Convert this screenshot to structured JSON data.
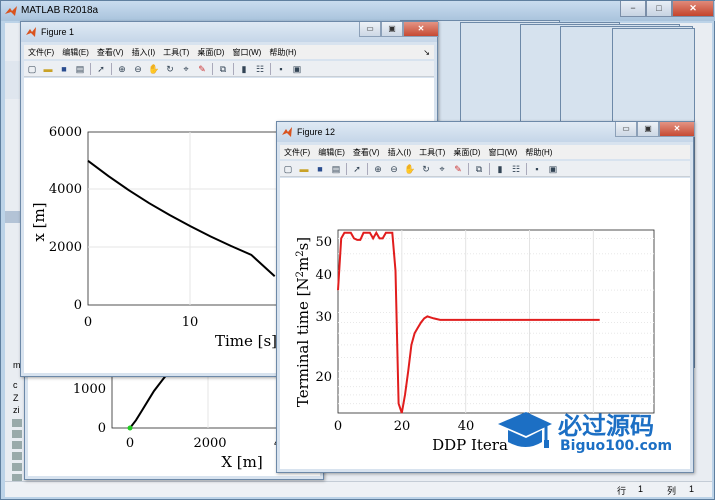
{
  "app": {
    "title": "MATLAB R2018a",
    "window_buttons": [
      "−",
      "□",
      "✕"
    ],
    "status_row_label": "行",
    "status_row_value": "1",
    "status_col_label": "列",
    "status_col_value": "1"
  },
  "figure_common": {
    "menu": [
      "文件(F)",
      "编辑(E)",
      "查看(V)",
      "插入(I)",
      "工具(T)",
      "桌面(D)",
      "窗口(W)",
      "帮助(H)"
    ],
    "window_buttons": [
      "▭",
      "▣",
      "✕"
    ],
    "menu_arrow": "↘"
  },
  "toolbar_icons": [
    "new-file-icon",
    "open-folder-icon",
    "save-icon",
    "print-icon",
    "pointer-icon",
    "zoom-in-icon",
    "zoom-out-icon",
    "pan-hand-icon",
    "rotate-3d-icon",
    "data-cursor-icon",
    "brush-icon",
    "link-plot-icon",
    "colorbar-icon",
    "legend-icon",
    "hide-tools-icon",
    "show-tools-icon"
  ],
  "figure1": {
    "title": "Figure 1",
    "chart_data": {
      "type": "line",
      "xlabel": "Time [s]",
      "ylabel": "x [m]",
      "xticks": [
        "0",
        "10"
      ],
      "yticks": [
        "0",
        "2000",
        "4000",
        "6000"
      ],
      "ylim": [
        0,
        6000
      ],
      "series": [
        {
          "x": [
            0,
            2,
            4,
            6,
            8,
            10,
            12,
            14,
            16,
            18.3
          ],
          "y": [
            5000,
            4470,
            3980,
            3530,
            3120,
            2740,
            2380,
            2050,
            1740,
            1000
          ]
        }
      ]
    }
  },
  "figure12": {
    "title": "Figure 12",
    "chart_data": {
      "type": "line",
      "xlabel": "DDP Itera",
      "ylabel": "Terminal time [N²m²s]",
      "ylabel_parts": [
        "Terminal time [N",
        "2",
        "m",
        "2",
        "s]"
      ],
      "xticks": [
        "0",
        "20",
        "40"
      ],
      "yticks": [
        "20",
        "30",
        "40",
        "50"
      ],
      "y_scale": "log",
      "ylim": [
        15,
        52
      ],
      "grid": true,
      "color": "#e11d1d",
      "series": [
        {
          "x": [
            0,
            1,
            2,
            3,
            4,
            5,
            6,
            7,
            8,
            9,
            10,
            11,
            12,
            13,
            14,
            15,
            16,
            17,
            18,
            19,
            20,
            21,
            22,
            23,
            24,
            25,
            26,
            27,
            28,
            29,
            30,
            32,
            34,
            36,
            40,
            50,
            60,
            70,
            80,
            82
          ],
          "y": [
            35,
            50,
            52,
            52,
            52,
            50,
            49.5,
            49.5,
            52,
            52,
            52,
            50,
            52,
            50,
            50,
            52,
            52,
            52,
            40,
            16,
            15,
            17,
            20,
            24,
            26,
            27,
            28,
            28.8,
            29.2,
            29,
            28.8,
            28.5,
            28.5,
            28.5,
            28.5,
            28.5,
            28.5,
            28.5,
            28.5,
            28.5
          ]
        }
      ]
    }
  },
  "figure_lower": {
    "chart_data": {
      "type": "line",
      "xlabel": "X [m]",
      "xticks": [
        "0",
        "2000",
        "4"
      ],
      "yticks": [
        "0",
        "1000"
      ],
      "series": [
        {
          "x": [
            0,
            150,
            300,
            450,
            600,
            750,
            900
          ],
          "y": [
            0,
            200,
            450,
            700,
            950,
            1150,
            1350
          ]
        }
      ]
    }
  },
  "side_labels": {
    "left_m": "m",
    "left_c": "c",
    "left_z": "Z",
    "left_zi": "zi"
  },
  "watermark": {
    "brand": "必过源码",
    "url": "Biguo100.com"
  }
}
